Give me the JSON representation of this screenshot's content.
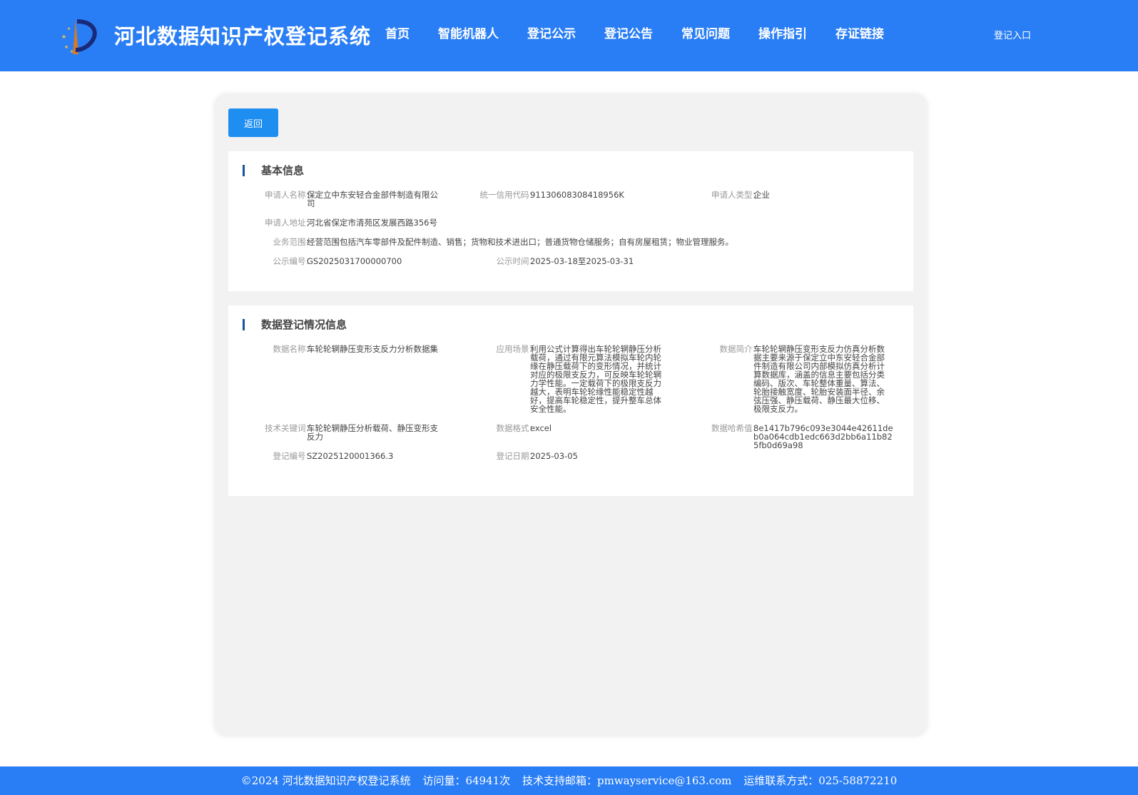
{
  "header": {
    "title": "河北数据知识产权登记系统",
    "nav": [
      "首页",
      "智能机器人",
      "登记公示",
      "登记公告",
      "常见问题",
      "操作指引",
      "存证链接"
    ],
    "login": "登记入口"
  },
  "back_label": "返回",
  "basic": {
    "title": "基本信息",
    "applicant_name_label": "申请人名称：",
    "applicant_name": "保定立中东安轻合金部件制造有限公司",
    "credit_code_label": "统一信用代码：",
    "credit_code": "91130608308418956K",
    "applicant_type_label": "申请人类型：",
    "applicant_type": "企业",
    "address_label": "申请人地址：",
    "address": "河北省保定市清苑区发展西路356号",
    "scope_label": "业务范围：",
    "scope": "经营范围包括汽车零部件及配件制造、销售；货物和技术进出口；普通货物仓储服务；自有房屋租赁；物业管理服务。",
    "pub_no_label": "公示编号：",
    "pub_no": "GS2025031700000700",
    "pub_time_label": "公示时间：",
    "pub_time": "2025-03-18至2025-03-31"
  },
  "registration": {
    "title": "数据登记情况信息",
    "data_name_label": "数据名称：",
    "data_name": "车轮轮辋静压变形支反力分析数据集",
    "scenario_label": "应用场景：",
    "scenario": "利用公式计算得出车轮轮辋静压分析载荷，通过有限元算法模拟车轮内轮缘在静压载荷下的变形情况，并统计对应的极限支反力，可反映车轮轮辋力学性能。一定载荷下的极限支反力越大，表明车轮轮缘性能稳定性越好，提高车轮稳定性，提升整车总体安全性能。",
    "intro_label": "数据简介：",
    "intro": "车轮轮辋静压变形支反力仿真分析数据主要来源于保定立中东安轻合金部件制造有限公司内部模拟仿真分析计算数据库，涵盖的信息主要包括分类编码、版次、车轮整体重量、算法、轮胎接触宽度、轮胎安装面半径、余弦压强、静压载荷、静压最大位移、极限支反力。",
    "keywords_label": "技术关键词：",
    "keywords": "车轮轮辋静压分析载荷、静压变形支反力",
    "format_label": "数据格式：",
    "format": "excel",
    "hash_label": "数据哈希值：",
    "hash": "8e1417b796c093e3044e42611deb0a064cdb1edc663d2bb6a11b825fb0d69a98",
    "reg_no_label": "登记编号：",
    "reg_no": "SZ2025120001366.3",
    "reg_date_label": "登记日期：",
    "reg_date": "2025-03-05"
  },
  "footer": {
    "copyright": "©2024 河北数据知识产权登记系统",
    "visits": "访问量：64941次",
    "email": "技术支持邮箱：pmwayservice@163.com",
    "phone": "运维联系方式：025-58872210"
  },
  "colors": {
    "brand": "#2a7ef5",
    "button": "#1e8ef0",
    "accent_bar": "#16569e"
  }
}
